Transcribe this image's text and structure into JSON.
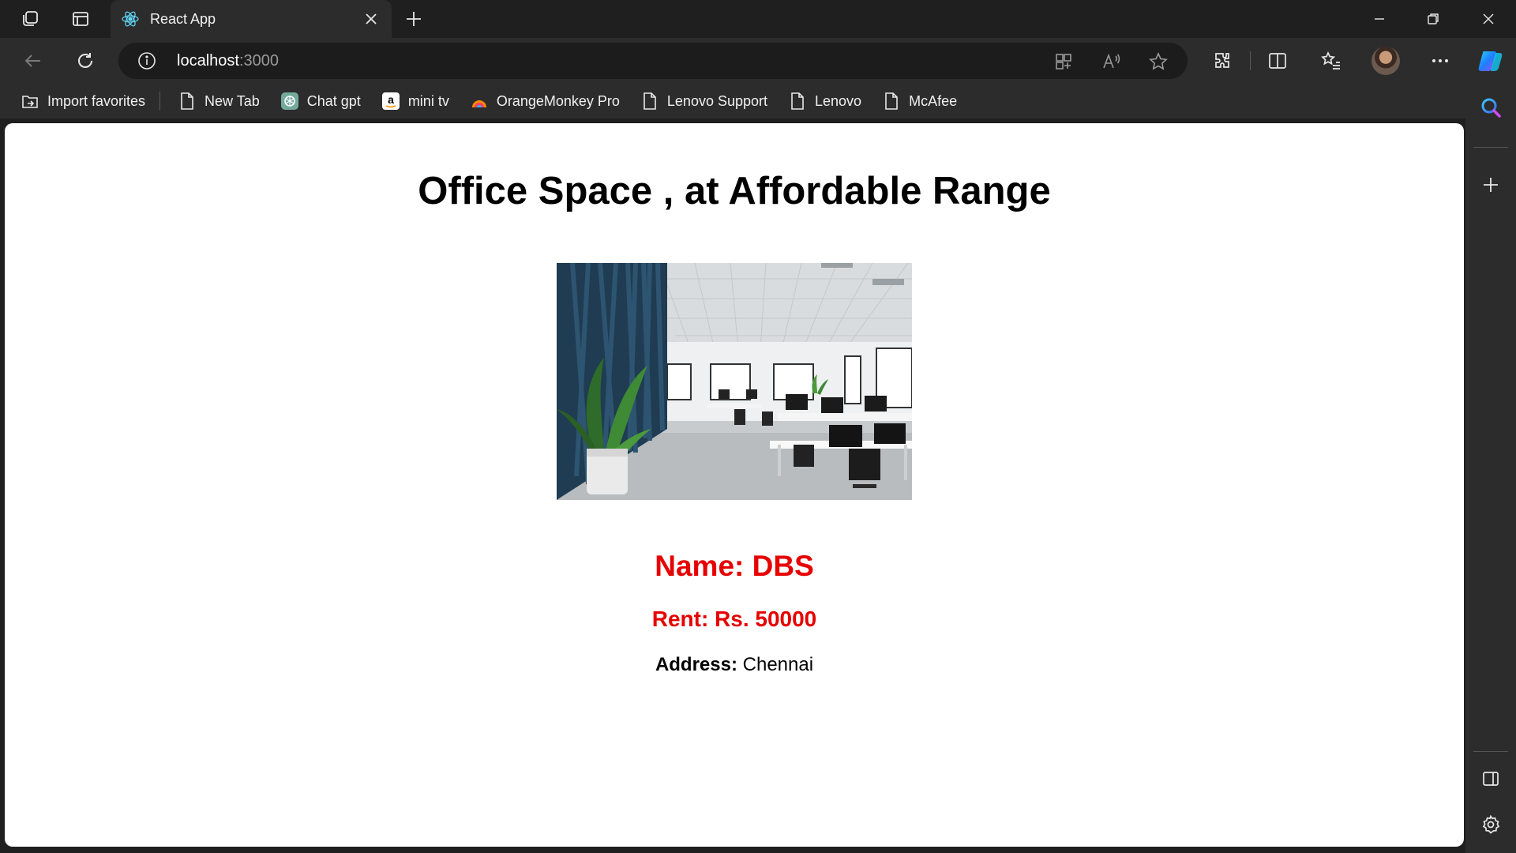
{
  "browser": {
    "tab_title": "React App",
    "url_host": "localhost",
    "url_port": ":3000",
    "favorites": [
      {
        "label": "Import favorites",
        "icon": "import-favorites-icon"
      },
      {
        "label": "New Tab",
        "icon": "page-icon"
      },
      {
        "label": "Chat gpt",
        "icon": "chatgpt-icon"
      },
      {
        "label": "mini tv",
        "icon": "amazon-icon"
      },
      {
        "label": "OrangeMonkey Pro",
        "icon": "orangemonkey-icon"
      },
      {
        "label": "Lenovo Support",
        "icon": "page-icon"
      },
      {
        "label": "Lenovo",
        "icon": "page-icon"
      },
      {
        "label": "McAfee",
        "icon": "page-icon"
      }
    ]
  },
  "page": {
    "heading": "Office Space , at Affordable Range",
    "image_alt": "office-interior-photo",
    "name_text": "Name: DBS",
    "rent_text": "Rent: Rs. 50000",
    "address_label": "Address:",
    "address_value": "Chennai"
  },
  "colors": {
    "accent_red": "#e60000",
    "browser_bg": "#1f1f1f",
    "page_bg": "#ffffff"
  }
}
